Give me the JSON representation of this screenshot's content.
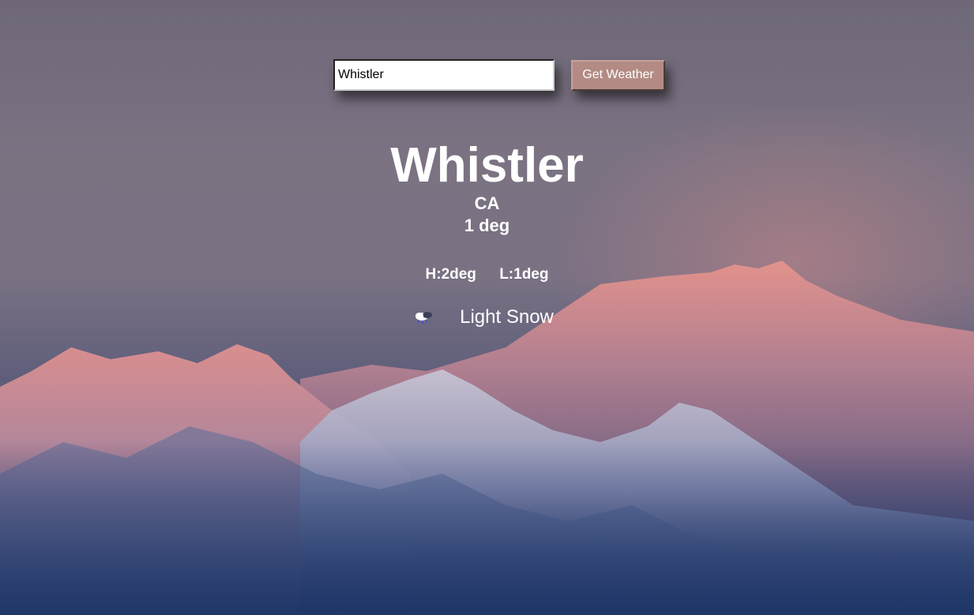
{
  "search": {
    "value": "Whistler",
    "button_label": "Get Weather"
  },
  "weather": {
    "city": "Whistler",
    "country": "CA",
    "temperature": "1 deg",
    "high": "H:2deg",
    "low": "L:1deg",
    "condition": "Light Snow",
    "condition_icon": "light-snow-icon"
  },
  "colors": {
    "button_bg": "#b38b84",
    "sky_top": "#6f6878",
    "valley_bottom": "#203767"
  }
}
